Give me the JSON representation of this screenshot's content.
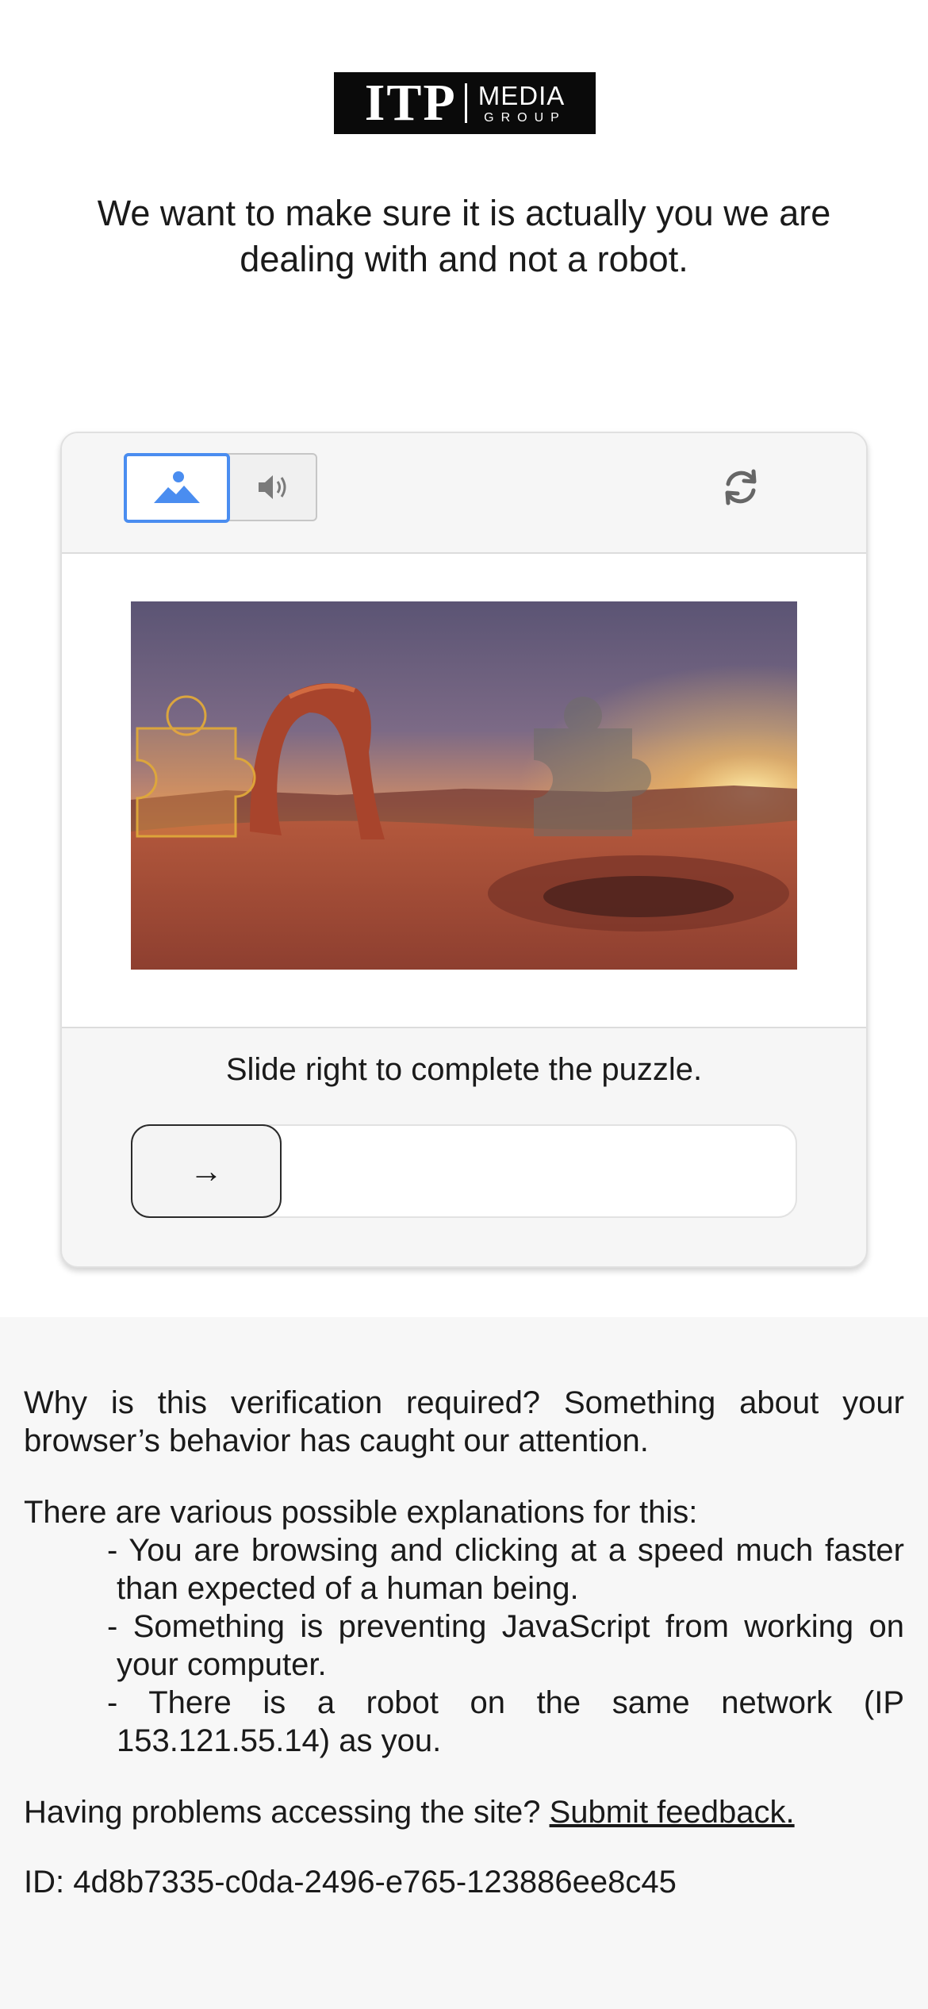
{
  "logo": {
    "primary": "ITP",
    "secondary": "MEDIA",
    "tertiary": "GROUP"
  },
  "headline": "We want to make sure it is actually you we are dealing with and not a robot.",
  "captcha": {
    "tabs": [
      {
        "name": "image-challenge",
        "icon": "image-icon",
        "active": true
      },
      {
        "name": "audio-challenge",
        "icon": "speaker-icon",
        "active": false
      }
    ],
    "refresh_icon": "refresh-icon",
    "instruction": "Slide right to complete the puzzle.",
    "slider_handle_icon": "→",
    "slider_progress": 0,
    "accent_color": "#4a8df0",
    "piece_outline_color": "#e0a93a"
  },
  "info": {
    "why": "Why is this verification required? Something about your browser’s behavior has caught our attention.",
    "explanations_intro": "There are various possible explanations for this:",
    "explanations": [
      "- You are browsing and clicking at a speed much faster than expected of a human being.",
      "- Something is preventing JavaScript from working on your computer.",
      "- There is a robot on the same network (IP 153.121.55.14) as you."
    ],
    "problems_text": "Having problems accessing the site?",
    "feedback_link": "Submit feedback.",
    "id_line": "ID: 4d8b7335-c0da-2496-e765-123886ee8c45"
  }
}
